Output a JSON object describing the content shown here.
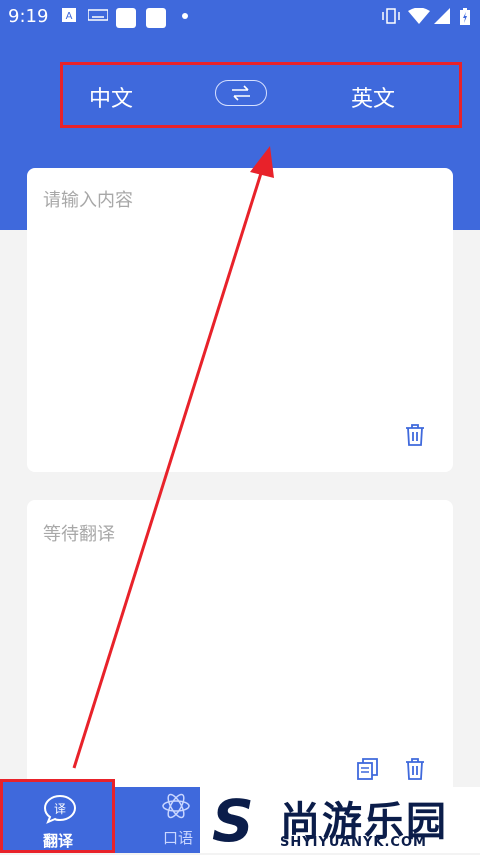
{
  "status_bar": {
    "time": "9:19"
  },
  "lang_bar": {
    "source_lang": "中文",
    "target_lang": "英文"
  },
  "input_card": {
    "placeholder": "请输入内容"
  },
  "output_card": {
    "placeholder": "等待翻译"
  },
  "bottom_nav": {
    "translate_label": "翻译",
    "oral_label": "口语"
  },
  "watermark": {
    "brand": "尚游乐园",
    "site": "SHYIYUANYK.COM"
  },
  "colors": {
    "accent": "#3f69dc",
    "highlight": "#e8222a"
  }
}
